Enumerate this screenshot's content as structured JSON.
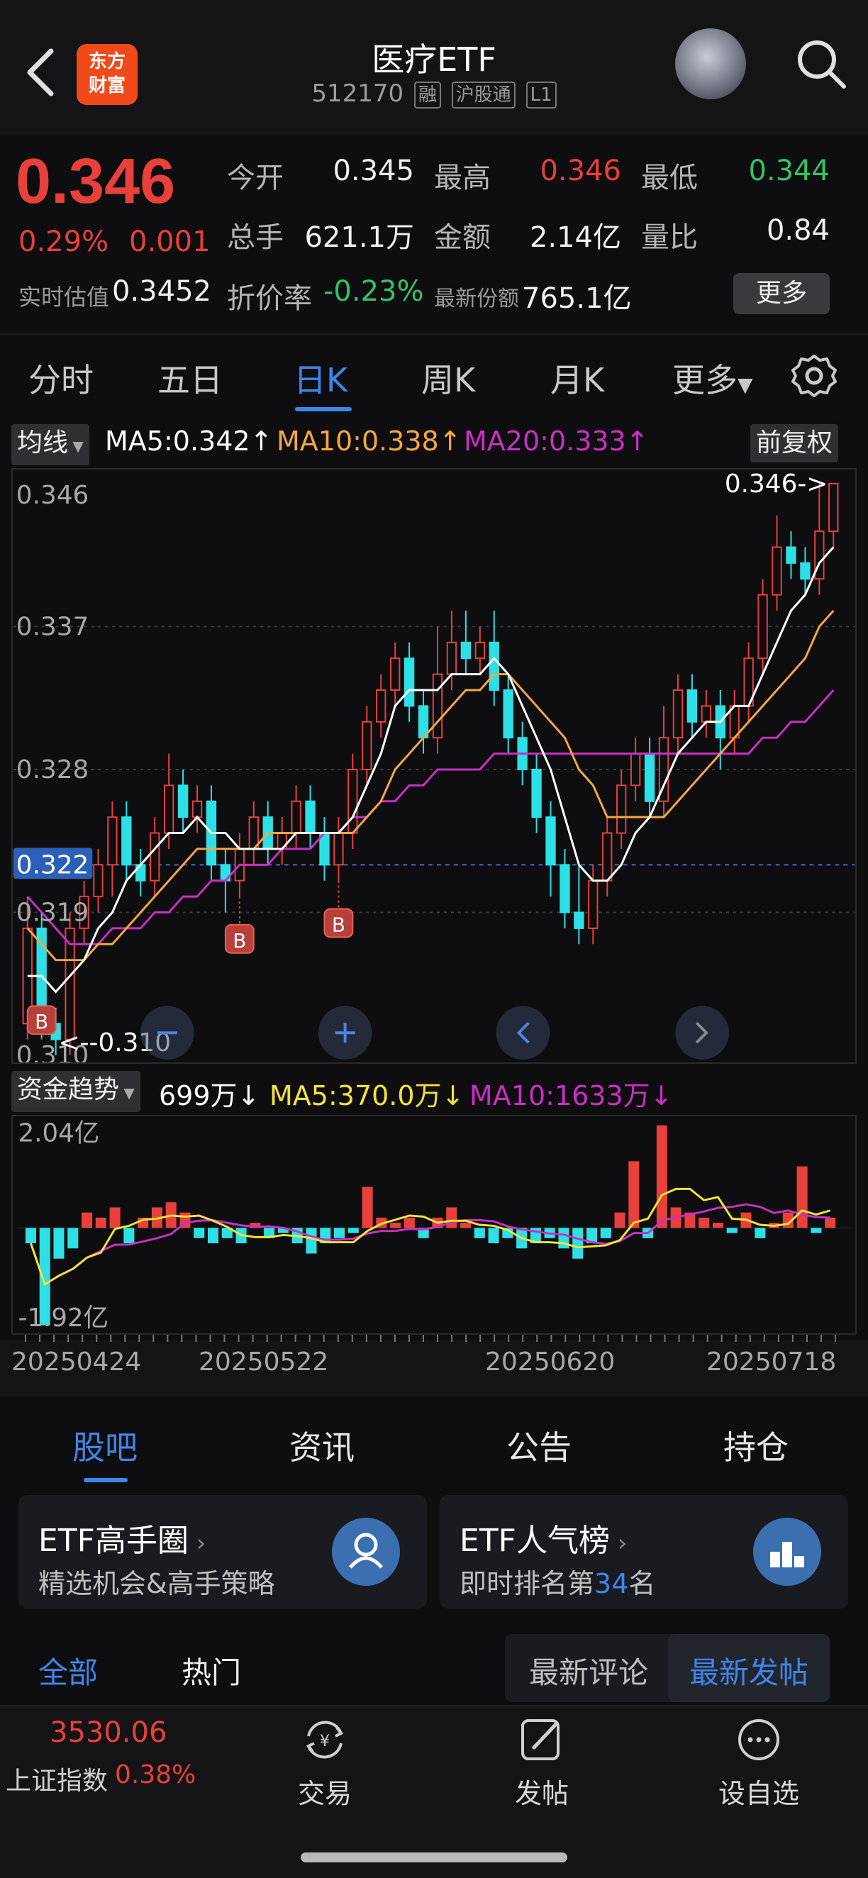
{
  "header": {
    "title": "医疗ETF",
    "code": "512170",
    "tags": [
      "融",
      "沪股通",
      "L1"
    ],
    "logo_line1": "东方",
    "logo_line2": "财富"
  },
  "quote": {
    "price": "0.346",
    "pct": "0.29%",
    "change": "0.001",
    "fields": [
      {
        "label": "今开",
        "value": "0.345",
        "color": "white"
      },
      {
        "label": "最高",
        "value": "0.346",
        "color": "red"
      },
      {
        "label": "最低",
        "value": "0.344",
        "color": "green"
      },
      {
        "label": "总手",
        "value": "621.1万",
        "color": "white"
      },
      {
        "label": "金额",
        "value": "2.14亿",
        "color": "white"
      },
      {
        "label": "量比",
        "value": "0.84",
        "color": "white"
      }
    ],
    "realtime_label": "实时估值",
    "realtime_value": "0.3452",
    "discount_label": "折价率",
    "discount_value": "-0.23%",
    "shares_label": "最新份额",
    "shares_value": "765.1亿",
    "more_label": "更多"
  },
  "period_tabs": [
    "分时",
    "五日",
    "日K",
    "周K",
    "月K",
    "更多"
  ],
  "active_period": "日K",
  "ma_bar": {
    "selector": "均线",
    "ma5": "MA5:0.342",
    "ma10": "MA10:0.338",
    "ma20": "MA20:0.333",
    "adjust": "前复权"
  },
  "colors": {
    "up": "#e8403a",
    "down": "#2de0e6",
    "ma5": "#ffffff",
    "ma10": "#f5a742",
    "ma20": "#c930c4",
    "accent": "#3f86ea"
  },
  "chart_data": {
    "type": "candlestick",
    "y_labels": [
      "0.346",
      "0.337",
      "0.328",
      "0.322",
      "0.319",
      "0.310"
    ],
    "current_price_label": "0.322",
    "max_marker": "0.346->",
    "min_marker": "<--0.310",
    "buy_marker": "B",
    "ylim": [
      0.31,
      0.346
    ],
    "candles": [
      [
        0.312,
        0.318,
        0.32,
        0.311
      ],
      [
        0.318,
        0.312,
        0.319,
        0.311
      ],
      [
        0.312,
        0.311,
        0.313,
        0.31
      ],
      [
        0.311,
        0.318,
        0.319,
        0.31
      ],
      [
        0.318,
        0.32,
        0.321,
        0.317
      ],
      [
        0.32,
        0.322,
        0.323,
        0.319
      ],
      [
        0.322,
        0.325,
        0.326,
        0.32
      ],
      [
        0.325,
        0.322,
        0.326,
        0.321
      ],
      [
        0.322,
        0.321,
        0.323,
        0.32
      ],
      [
        0.321,
        0.324,
        0.325,
        0.32
      ],
      [
        0.324,
        0.327,
        0.329,
        0.323
      ],
      [
        0.327,
        0.325,
        0.328,
        0.324
      ],
      [
        0.325,
        0.326,
        0.327,
        0.324
      ],
      [
        0.326,
        0.322,
        0.327,
        0.321
      ],
      [
        0.322,
        0.321,
        0.323,
        0.319
      ],
      [
        0.321,
        0.323,
        0.324,
        0.32
      ],
      [
        0.323,
        0.325,
        0.326,
        0.322
      ],
      [
        0.325,
        0.323,
        0.326,
        0.322
      ],
      [
        0.323,
        0.324,
        0.325,
        0.322
      ],
      [
        0.324,
        0.326,
        0.327,
        0.323
      ],
      [
        0.326,
        0.324,
        0.327,
        0.323
      ],
      [
        0.324,
        0.322,
        0.325,
        0.321
      ],
      [
        0.322,
        0.324,
        0.325,
        0.321
      ],
      [
        0.324,
        0.328,
        0.329,
        0.323
      ],
      [
        0.328,
        0.331,
        0.332,
        0.327
      ],
      [
        0.331,
        0.333,
        0.334,
        0.33
      ],
      [
        0.333,
        0.335,
        0.336,
        0.332
      ],
      [
        0.335,
        0.332,
        0.336,
        0.331
      ],
      [
        0.332,
        0.33,
        0.333,
        0.329
      ],
      [
        0.33,
        0.334,
        0.337,
        0.329
      ],
      [
        0.334,
        0.336,
        0.338,
        0.333
      ],
      [
        0.336,
        0.335,
        0.338,
        0.334
      ],
      [
        0.335,
        0.336,
        0.337,
        0.334
      ],
      [
        0.336,
        0.333,
        0.338,
        0.332
      ],
      [
        0.333,
        0.33,
        0.334,
        0.329
      ],
      [
        0.33,
        0.328,
        0.331,
        0.327
      ],
      [
        0.328,
        0.325,
        0.329,
        0.324
      ],
      [
        0.325,
        0.322,
        0.326,
        0.32
      ],
      [
        0.322,
        0.319,
        0.323,
        0.318
      ],
      [
        0.319,
        0.318,
        0.322,
        0.317
      ],
      [
        0.318,
        0.321,
        0.322,
        0.317
      ],
      [
        0.321,
        0.324,
        0.325,
        0.32
      ],
      [
        0.324,
        0.327,
        0.328,
        0.323
      ],
      [
        0.327,
        0.329,
        0.33,
        0.326
      ],
      [
        0.329,
        0.326,
        0.33,
        0.325
      ],
      [
        0.326,
        0.33,
        0.332,
        0.325
      ],
      [
        0.33,
        0.333,
        0.334,
        0.329
      ],
      [
        0.333,
        0.331,
        0.334,
        0.33
      ],
      [
        0.331,
        0.332,
        0.333,
        0.33
      ],
      [
        0.332,
        0.33,
        0.333,
        0.328
      ],
      [
        0.33,
        0.332,
        0.333,
        0.329
      ],
      [
        0.332,
        0.335,
        0.336,
        0.331
      ],
      [
        0.335,
        0.339,
        0.34,
        0.334
      ],
      [
        0.339,
        0.342,
        0.344,
        0.338
      ],
      [
        0.342,
        0.341,
        0.343,
        0.34
      ],
      [
        0.341,
        0.34,
        0.342,
        0.339
      ],
      [
        0.34,
        0.343,
        0.346,
        0.339
      ],
      [
        0.343,
        0.346,
        0.346,
        0.342
      ]
    ],
    "ma5": [
      0.315,
      0.315,
      0.314,
      0.315,
      0.316,
      0.318,
      0.319,
      0.321,
      0.322,
      0.323,
      0.324,
      0.324,
      0.325,
      0.324,
      0.324,
      0.323,
      0.323,
      0.323,
      0.323,
      0.324,
      0.324,
      0.324,
      0.324,
      0.325,
      0.327,
      0.329,
      0.332,
      0.333,
      0.333,
      0.333,
      0.334,
      0.334,
      0.334,
      0.335,
      0.334,
      0.332,
      0.33,
      0.328,
      0.325,
      0.322,
      0.321,
      0.321,
      0.322,
      0.324,
      0.325,
      0.327,
      0.329,
      0.33,
      0.331,
      0.331,
      0.332,
      0.332,
      0.334,
      0.336,
      0.338,
      0.339,
      0.341,
      0.342
    ],
    "ma10": [
      0.318,
      0.317,
      0.316,
      0.316,
      0.316,
      0.317,
      0.317,
      0.318,
      0.319,
      0.32,
      0.321,
      0.322,
      0.323,
      0.323,
      0.323,
      0.323,
      0.323,
      0.324,
      0.324,
      0.324,
      0.324,
      0.324,
      0.324,
      0.324,
      0.325,
      0.326,
      0.328,
      0.329,
      0.33,
      0.331,
      0.332,
      0.333,
      0.333,
      0.334,
      0.334,
      0.333,
      0.332,
      0.331,
      0.33,
      0.328,
      0.327,
      0.325,
      0.325,
      0.325,
      0.325,
      0.325,
      0.326,
      0.327,
      0.328,
      0.329,
      0.33,
      0.331,
      0.332,
      0.333,
      0.334,
      0.335,
      0.337,
      0.338
    ],
    "ma20": [
      0.32,
      0.319,
      0.318,
      0.317,
      0.317,
      0.317,
      0.318,
      0.318,
      0.318,
      0.319,
      0.319,
      0.32,
      0.32,
      0.321,
      0.321,
      0.322,
      0.322,
      0.322,
      0.323,
      0.323,
      0.323,
      0.324,
      0.324,
      0.325,
      0.325,
      0.326,
      0.326,
      0.327,
      0.327,
      0.328,
      0.328,
      0.328,
      0.328,
      0.329,
      0.329,
      0.329,
      0.329,
      0.329,
      0.329,
      0.329,
      0.329,
      0.329,
      0.329,
      0.329,
      0.329,
      0.329,
      0.329,
      0.329,
      0.329,
      0.329,
      0.329,
      0.329,
      0.33,
      0.33,
      0.331,
      0.331,
      0.332,
      0.333
    ],
    "buy_points": [
      1,
      15,
      22
    ]
  },
  "flow_bar": {
    "selector": "资金趋势",
    "value": "699万",
    "ma5": "MA5:370.0万",
    "ma10": "MA10:1633万",
    "top_label": "2.04亿",
    "bottom_label": "-1.92亿",
    "ylim": [
      -1.92,
      2.04
    ],
    "bars": [
      -0.3,
      -1.9,
      -0.6,
      -0.4,
      0.3,
      0.2,
      0.4,
      -0.3,
      0.2,
      0.4,
      0.5,
      0.3,
      -0.2,
      -0.3,
      -0.2,
      -0.3,
      0.1,
      -0.2,
      -0.1,
      -0.3,
      -0.5,
      -0.3,
      -0.2,
      -0.1,
      0.8,
      0.2,
      0.1,
      0.2,
      -0.2,
      0.2,
      0.4,
      0.1,
      -0.2,
      -0.3,
      -0.2,
      -0.4,
      -0.3,
      -0.2,
      -0.4,
      -0.6,
      -0.3,
      -0.2,
      0.3,
      1.3,
      -0.2,
      2.0,
      0.4,
      0.3,
      0.2,
      0.1,
      -0.1,
      0.3,
      -0.2,
      0.1,
      0.3,
      1.2,
      -0.1,
      0.2
    ]
  },
  "x_labels": [
    "20250424",
    "20250522",
    "20250620",
    "20250718"
  ],
  "content_tabs": [
    "股吧",
    "资讯",
    "公告",
    "持仓"
  ],
  "cards": [
    {
      "title": "ETF高手圈",
      "sub": "精选机会&高手策略"
    },
    {
      "title": "ETF人气榜",
      "sub_pre": "即时排名第",
      "sub_num": "34",
      "sub_post": "名"
    }
  ],
  "filters": {
    "all": "全部",
    "hot": "热门",
    "latest_comment": "最新评论",
    "latest_post": "最新发帖"
  },
  "bottom": {
    "index_value": "3530.06",
    "index_name": "上证指数",
    "index_pct": "0.38%",
    "nav": [
      "交易",
      "发帖",
      "设自选"
    ]
  }
}
